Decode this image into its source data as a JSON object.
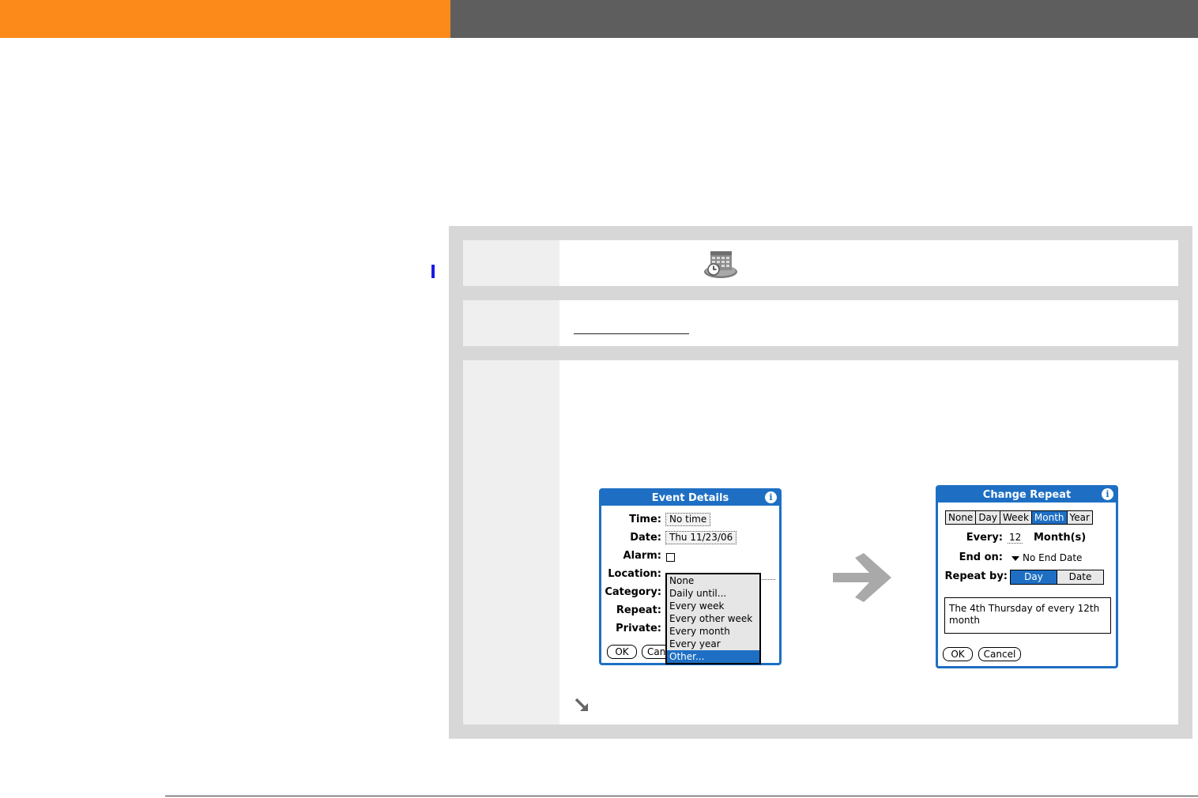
{
  "event_details": {
    "title": "Event Details",
    "info_glyph": "i",
    "labels": {
      "time": "Time:",
      "date": "Date:",
      "alarm": "Alarm:",
      "location": "Location:",
      "category": "Category:",
      "repeat": "Repeat:",
      "private": "Private:"
    },
    "time_value": "No time",
    "date_value": "Thu 11/23/06",
    "ok_label": "OK",
    "cancel_label": "Canc",
    "repeat_options": [
      "None",
      "Daily until...",
      "Every week",
      "Every other week",
      "Every month",
      "Every year",
      "Other..."
    ],
    "selected_option": "Other..."
  },
  "change_repeat": {
    "title": "Change Repeat",
    "info_glyph": "i",
    "tabs": [
      "None",
      "Day",
      "Week",
      "Month",
      "Year"
    ],
    "active_tab": "Month",
    "every_label": "Every:",
    "every_value": "12",
    "every_unit": "Month(s)",
    "end_on_label": "End on:",
    "end_on_value": "No End Date",
    "repeat_by_label": "Repeat by:",
    "repeat_by_options": [
      "Day",
      "Date"
    ],
    "repeat_by_active": "Day",
    "description": "The 4th Thursday of every 12th month",
    "ok_label": "OK",
    "cancel_label": "Cancel"
  },
  "colors": {
    "accent_orange": "#FC8A1B",
    "header_gray": "#5E5E5E",
    "palm_blue": "#1E6FC4",
    "marker_blue": "#1A1AE6"
  },
  "icons": {
    "calendar": "calendar-app-icon",
    "arrow": "right-arrow-icon",
    "continue": "continued-arrow-icon"
  }
}
